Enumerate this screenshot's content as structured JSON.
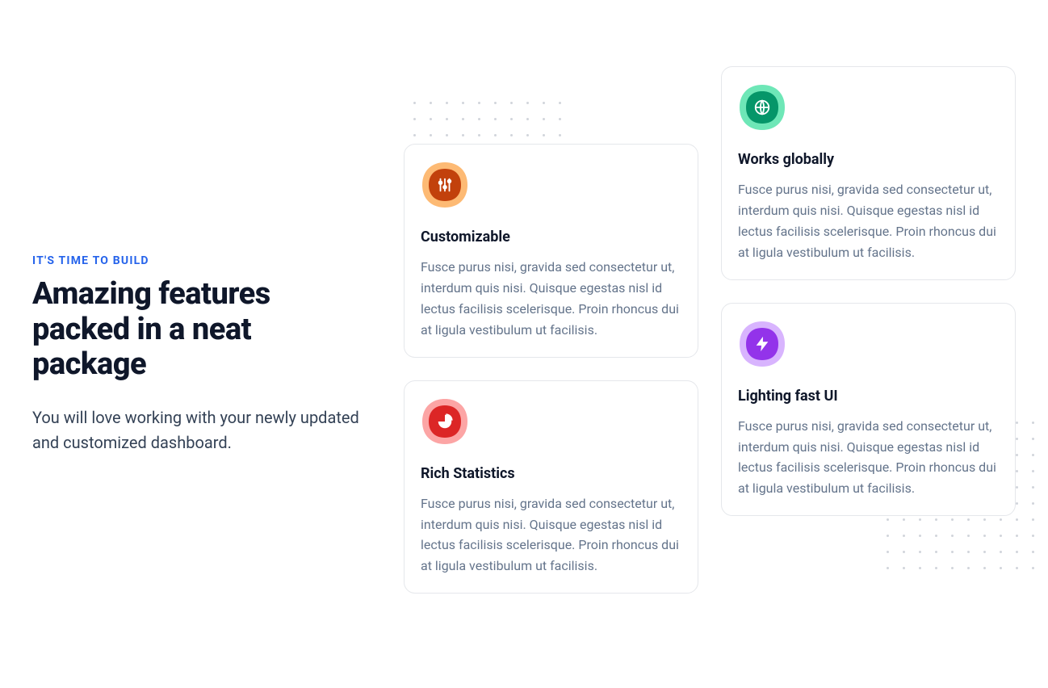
{
  "intro": {
    "eyebrow": "IT'S TIME TO BUILD",
    "headline": "Amazing features packed in a neat package",
    "subhead": "You will love working with your newly updated and customized dashboard."
  },
  "features": [
    {
      "icon": "sliders-icon",
      "title": "Customizable",
      "text": "Fusce purus nisi, gravida sed consectetur ut, interdum quis nisi. Quisque egestas nisl id lectus facilisis scelerisque. Proin rhoncus dui at ligula vestibulum ut facilisis.",
      "colors": {
        "outer": "#fdba74",
        "inner": "#c2410c"
      }
    },
    {
      "icon": "pie-chart-icon",
      "title": "Rich Statistics",
      "text": "Fusce purus nisi, gravida sed consectetur ut, interdum quis nisi. Quisque egestas nisl id lectus facilisis scelerisque. Proin rhoncus dui at ligula vestibulum ut facilisis.",
      "colors": {
        "outer": "#fca5a5",
        "inner": "#dc2626"
      }
    },
    {
      "icon": "globe-icon",
      "title": "Works globally",
      "text": "Fusce purus nisi, gravida sed consectetur ut, interdum quis nisi. Quisque egestas nisl id lectus facilisis scelerisque. Proin rhoncus dui at ligula vestibulum ut facilisis.",
      "colors": {
        "outer": "#6ee7b7",
        "inner": "#059669"
      }
    },
    {
      "icon": "bolt-icon",
      "title": "Lighting fast UI",
      "text": "Fusce purus nisi, gravida sed consectetur ut, interdum quis nisi. Quisque egestas nisl id lectus facilisis scelerisque. Proin rhoncus dui at ligula vestibulum ut facilisis.",
      "colors": {
        "outer": "#d8b4fe",
        "inner": "#9333ea"
      }
    }
  ]
}
